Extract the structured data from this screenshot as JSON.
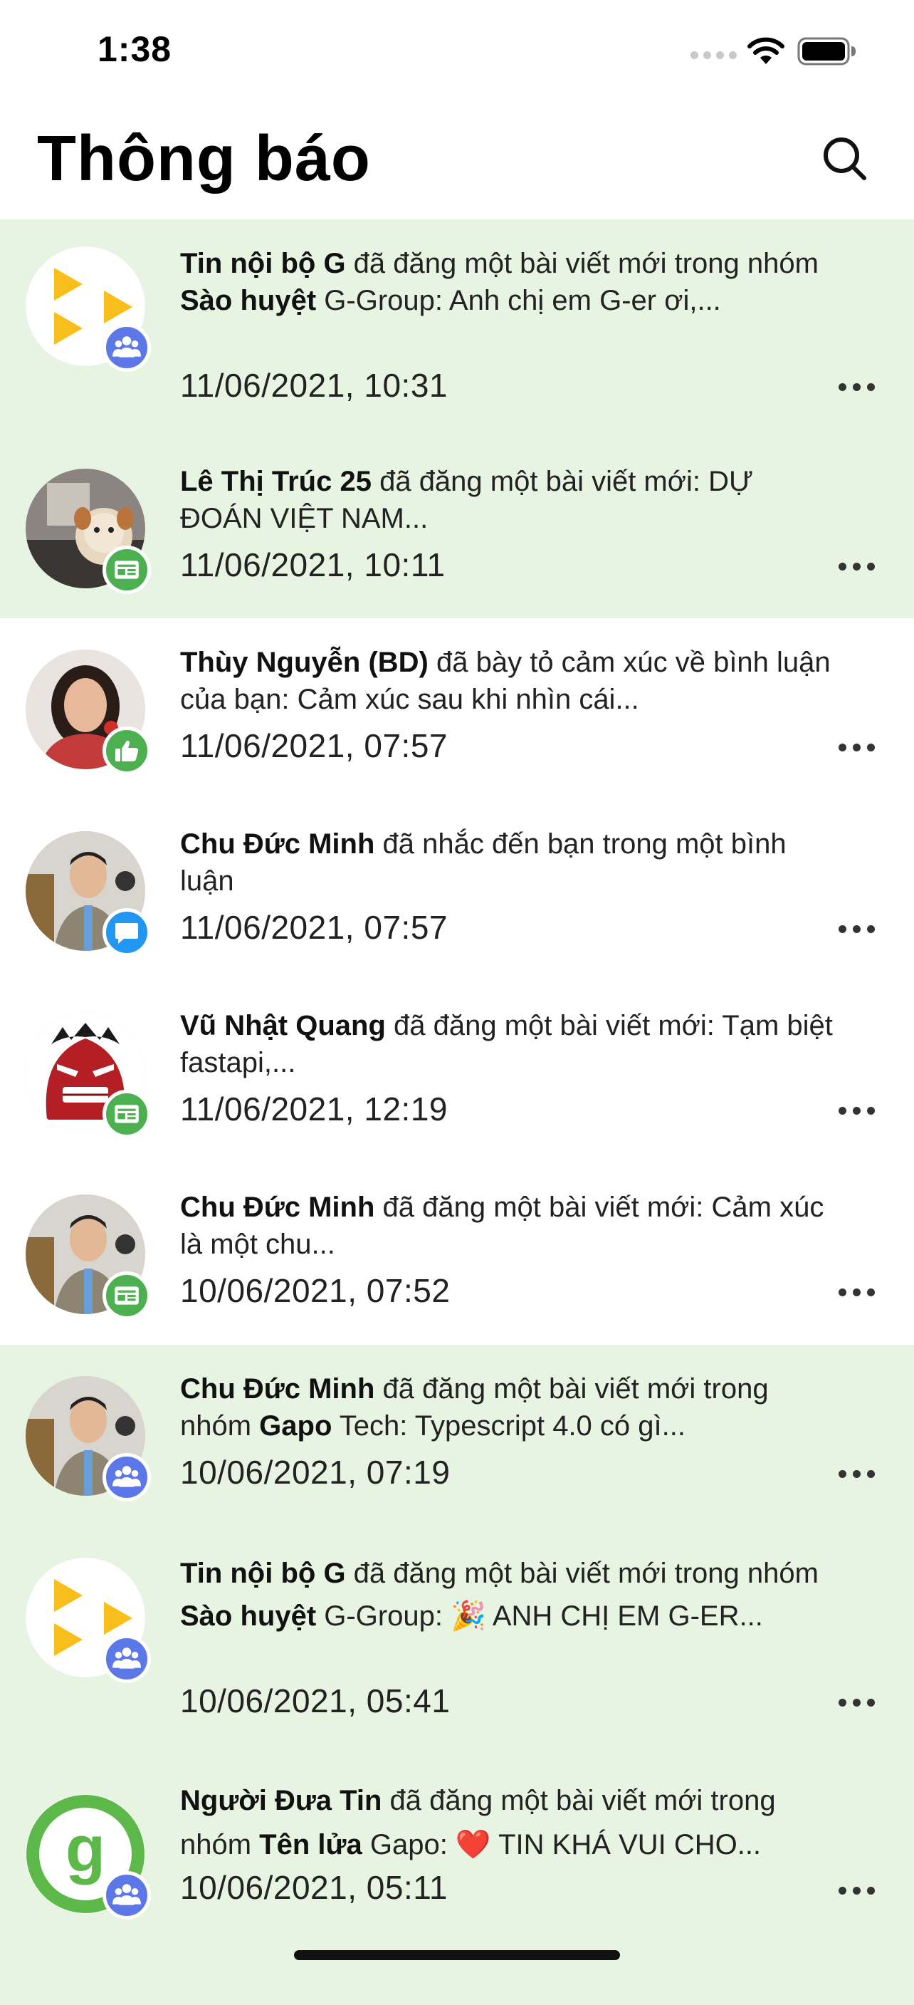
{
  "status_bar": {
    "time": "1:38"
  },
  "header": {
    "title": "Thông báo"
  },
  "notifications": [
    {
      "actor": "Tin nội bộ G",
      "text_1": " đã đăng một bài viết mới trong nhóm ",
      "group": "Sào huyệt",
      "text_2": " G-Group: Anh chị em G-er ơi,...",
      "time": "11/06/2021, 10:31",
      "avatar": "gapo-play-logo",
      "badge": "group-icon",
      "unread": true
    },
    {
      "actor": "Lê Thị Trúc 25",
      "text_1": " đã đăng một bài viết mới: DỰ ĐOÁN VIỆT NAM...",
      "time": "11/06/2021, 10:11",
      "avatar": "user-photo",
      "badge": "post-icon",
      "unread": true
    },
    {
      "actor": "Thùy Nguyễn (BD)",
      "text_1": " đã bày tỏ cảm xúc về bình luận của bạn: Cảm xúc sau khi nhìn cái...",
      "time": "11/06/2021, 07:57",
      "avatar": "user-photo",
      "badge": "like-icon",
      "unread": false
    },
    {
      "actor": "Chu Đức Minh",
      "text_1": " đã nhắc đến bạn trong một bình luận",
      "time": "11/06/2021, 07:57",
      "avatar": "user-photo",
      "badge": "comment-icon",
      "unread": false
    },
    {
      "actor": "Vũ Nhật Quang",
      "text_1": " đã đăng một bài viết mới: Tạm biệt fastapi,...",
      "time": "11/06/2021, 12:19",
      "avatar": "hulk-avatar",
      "badge": "post-icon",
      "unread": false
    },
    {
      "actor": "Chu Đức Minh",
      "text_1": " đã đăng một bài viết mới: Cảm xúc là một chu...",
      "time": "10/06/2021, 07:52",
      "avatar": "user-photo",
      "badge": "post-icon",
      "unread": false
    },
    {
      "actor": "Chu Đức Minh",
      "text_1": " đã đăng một bài viết mới trong nhóm ",
      "group": "Gapo",
      "text_2": " Tech: Typescript 4.0 có gì...",
      "time": "10/06/2021, 07:19",
      "avatar": "user-photo",
      "badge": "group-icon",
      "unread": true
    },
    {
      "actor": "Tin nội bộ G",
      "text_1": " đã đăng một bài viết mới trong nhóm ",
      "group": "Sào huyệt",
      "text_2": " G-Group: 🎉 ANH CHỊ EM G-ER...",
      "time": "10/06/2021, 05:41",
      "avatar": "gapo-play-logo",
      "badge": "group-icon",
      "unread": true
    },
    {
      "actor": "Người Đưa Tin",
      "text_1": " đã đăng một bài viết mới trong nhóm ",
      "group": "Tên lửa",
      "text_2": " Gapo: ❤️ TIN KHÁ VUI CHO...",
      "time": "10/06/2021, 05:11",
      "avatar": "gapo-g-logo",
      "badge": "group-icon",
      "unread": true
    }
  ]
}
